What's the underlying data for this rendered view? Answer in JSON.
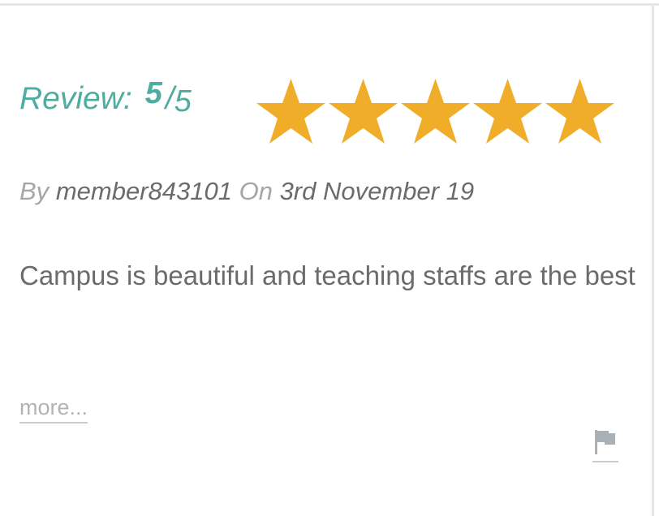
{
  "review": {
    "label": "Review:",
    "score": "5",
    "slash": "/",
    "max": "5",
    "rating_value": 5,
    "rating_max": 5,
    "star_color": "#f0ad2a",
    "accent_color": "#4dada0"
  },
  "byline": {
    "by_label": "By",
    "author": "member843101",
    "on_label": "On",
    "date": "3rd November 19"
  },
  "body": {
    "text": "Campus is beautiful and teaching staffs are the best"
  },
  "actions": {
    "more_label": "more...",
    "flag_icon": "flag-icon"
  }
}
